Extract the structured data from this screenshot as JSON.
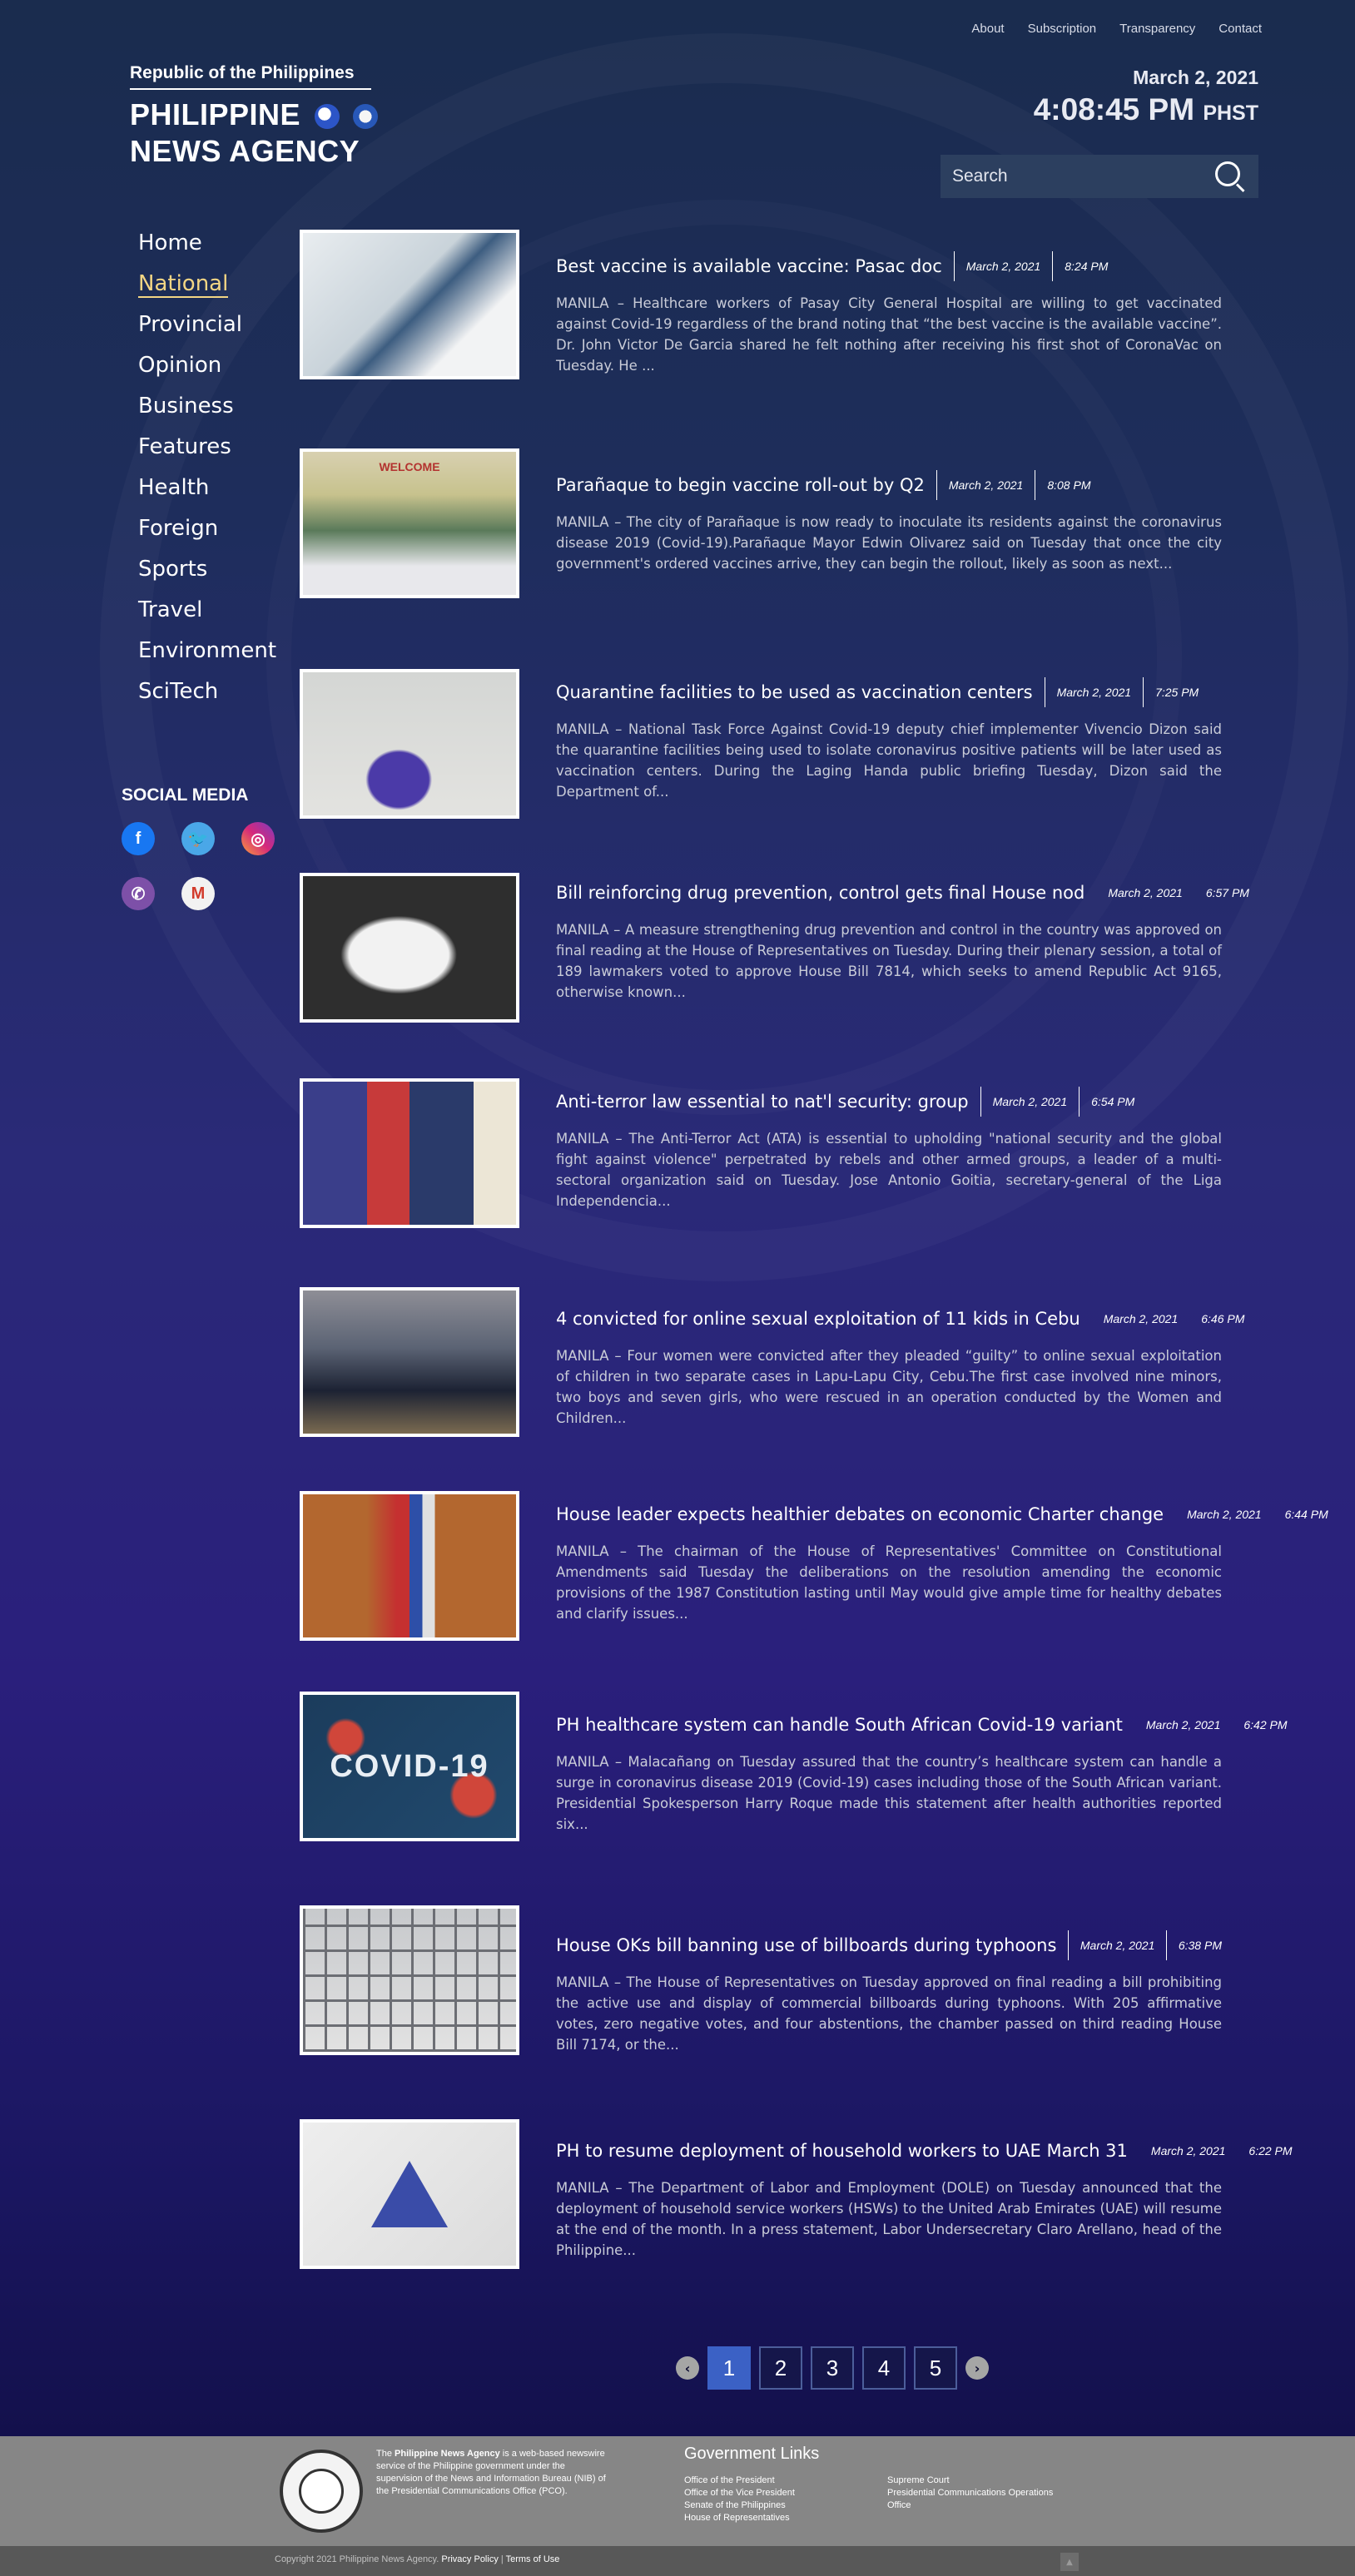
{
  "topnav": [
    "About",
    "Subscription",
    "Transparency",
    "Contact"
  ],
  "brand": {
    "republic": "Republic of the Philippines",
    "line1": "PHILIPPINE",
    "line2": "NEWS AGENCY"
  },
  "datetime": {
    "date": "March 2, 2021",
    "time": "4:08:45 PM",
    "tz": "PHST"
  },
  "search": {
    "placeholder": "Search"
  },
  "sidenav": [
    "Home",
    "National",
    "Provincial",
    "Opinion",
    "Business",
    "Features",
    "Health",
    "Foreign",
    "Sports",
    "Travel",
    "Environment",
    "SciTech"
  ],
  "sidenav_active": "National",
  "social": {
    "title": "SOCIAL MEDIA",
    "icons": [
      "facebook-icon",
      "twitter-icon",
      "instagram-icon",
      "viber-icon",
      "gmail-icon"
    ]
  },
  "articles": [
    {
      "title": "Best vaccine is available vaccine: Pasac doc",
      "date": "March 2, 2021",
      "time": "8:24 PM",
      "excerpt": "MANILA – Healthcare workers of Pasay City General Hospital are willing to get vaccinated against Covid-19 regardless of the brand noting that “the best vaccine is the available vaccine”. Dr. John Victor De Garcia shared he felt nothing after receiving his first shot of CoronaVac on Tuesday. He ..."
    },
    {
      "title": "Parañaque to begin vaccine roll-out by Q2",
      "date": "March 2, 2021",
      "time": "8:08 PM",
      "excerpt": "MANILA – The city of Parañaque is now ready to inoculate its residents against the coronavirus disease 2019 (Covid-19).Parañaque Mayor Edwin Olivarez said on Tuesday that once the city government's ordered vaccines arrive, they can begin the rollout, likely as soon as next..."
    },
    {
      "title": "Quarantine facilities to be used as vaccination centers",
      "date": "March 2, 2021",
      "time": "7:25 PM",
      "excerpt": "MANILA – National Task Force Against Covid-19 deputy chief implementer Vivencio Dizon said the quarantine facilities being used to isolate coronavirus positive patients will be later used as vaccination centers. During the Laging Handa public briefing Tuesday, Dizon said the Department of..."
    },
    {
      "title": "Bill reinforcing drug prevention, control gets final House nod",
      "date": "March 2, 2021",
      "time": "6:57 PM",
      "excerpt": "MANILA – A measure strengthening drug prevention and control in the country was approved on final reading at the House of Representatives on Tuesday. During their plenary session, a total of 189 lawmakers voted to approve House Bill 7814, which seeks to amend Republic Act 9165, otherwise known..."
    },
    {
      "title": "Anti-terror law essential to nat'l security: group",
      "date": "March 2, 2021",
      "time": "6:54 PM",
      "excerpt": "MANILA – The Anti-Terror Act (ATA) is essential to upholding \"national security and the global fight against violence\" perpetrated by rebels and other armed groups, a leader of a multi-sectoral organization said on Tuesday. Jose Antonio Goitia, secretary-general of the Liga Independencia..."
    },
    {
      "title": "4 convicted for online sexual exploitation of 11 kids in Cebu",
      "date": "March 2, 2021",
      "time": "6:46 PM",
      "excerpt": "MANILA – Four women were convicted after they pleaded “guilty” to online sexual exploitation of children in two separate cases in Lapu-Lapu City, Cebu.The first case involved nine minors, two boys and seven girls, who were rescued in an operation conducted by the Women and Children..."
    },
    {
      "title": "House leader expects healthier debates on economic Charter change",
      "date": "March 2, 2021",
      "time": "6:44 PM",
      "excerpt": "MANILA – The chairman of the House of Representatives' Committee on Constitutional Amendments said Tuesday the deliberations on the resolution amending the economic provisions of the 1987 Constitution lasting until May would give ample time for healthy debates and clarify issues..."
    },
    {
      "title": "PH healthcare system can handle South African Covid-19 variant",
      "date": "March 2, 2021",
      "time": "6:42 PM",
      "excerpt": "MANILA – Malacañang on Tuesday assured that the country’s healthcare system can handle a surge in coronavirus disease 2019 (Covid-19) cases including those of the South African variant. Presidential Spokesperson Harry Roque made this statement after health authorities reported six..."
    },
    {
      "title": "House OKs bill banning use of billboards during typhoons",
      "date": "March 2, 2021",
      "time": "6:38 PM",
      "excerpt": "MANILA – The House of Representatives on Tuesday approved on final reading a bill prohibiting the active use and display of commercial billboards during typhoons. With 205 affirmative votes, zero negative votes, and four abstentions, the chamber passed on third reading House Bill 7174, or the..."
    },
    {
      "title": "PH to resume deployment of household workers to UAE March 31",
      "date": "March 2, 2021",
      "time": "6:22 PM",
      "excerpt": "MANILA – The Department of Labor and Employment (DOLE) on Tuesday announced that the deployment of household service workers (HSWs) to the United Arab Emirates (UAE) will resume at the end of the month. In a press statement, Labor Undersecretary Claro Arellano, head of the Philippine..."
    }
  ],
  "thumb_texts": {
    "welcome": "WELCOME",
    "covid": "COVID-19"
  },
  "pagination": {
    "pages": [
      "1",
      "2",
      "3",
      "4",
      "5"
    ],
    "active": "1"
  },
  "footer": {
    "about_pre": "The ",
    "about_strong": "Philippine News Agency",
    "about_post": " is a web-based newswire service of the Philippine government under the supervision of the News and Information Bureau (NIB) of the Presidential Communications Office (PCO).",
    "gov_title": "Government Links",
    "gov_col1": [
      "Office of the President",
      "Office of the Vice President",
      "Senate of the Philippines",
      "House of Representatives"
    ],
    "gov_col2": [
      "Supreme Court",
      "Presidential Communications Operations",
      "Office"
    ]
  },
  "copyright": {
    "text": "Copyright 2021 Philippine News Agency. ",
    "privacy": "Privacy Policy",
    "divider": " | ",
    "terms": "Terms of Use"
  }
}
